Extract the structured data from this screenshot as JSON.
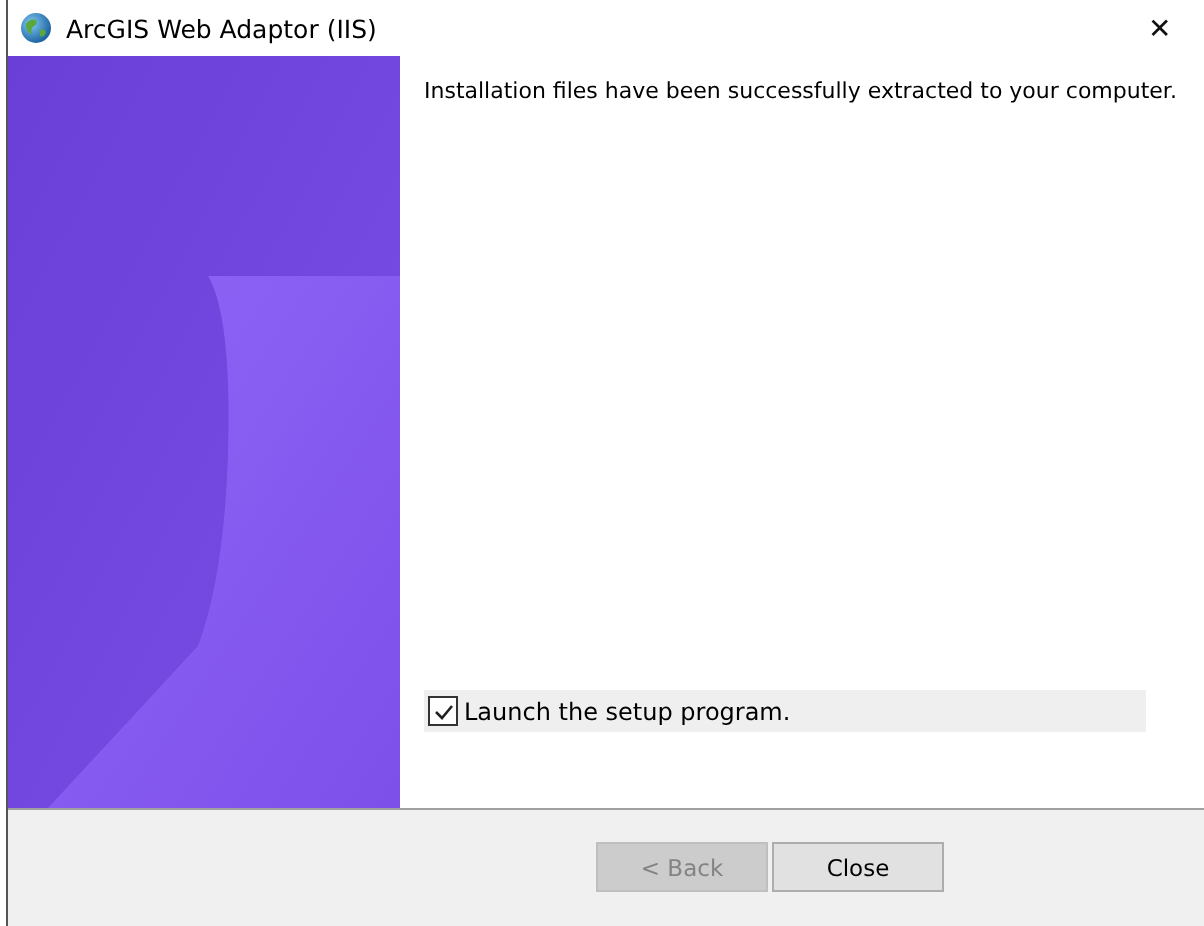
{
  "window": {
    "title": "ArcGIS Web Adaptor (IIS)",
    "close": "✕"
  },
  "message": "Installation files have been successfully extracted to your computer.",
  "launch_option": {
    "label": "Launch the setup program.",
    "checked": true
  },
  "buttons": [
    {
      "label": "< Back",
      "disabled": true
    },
    {
      "label": "Close",
      "disabled": false
    }
  ]
}
